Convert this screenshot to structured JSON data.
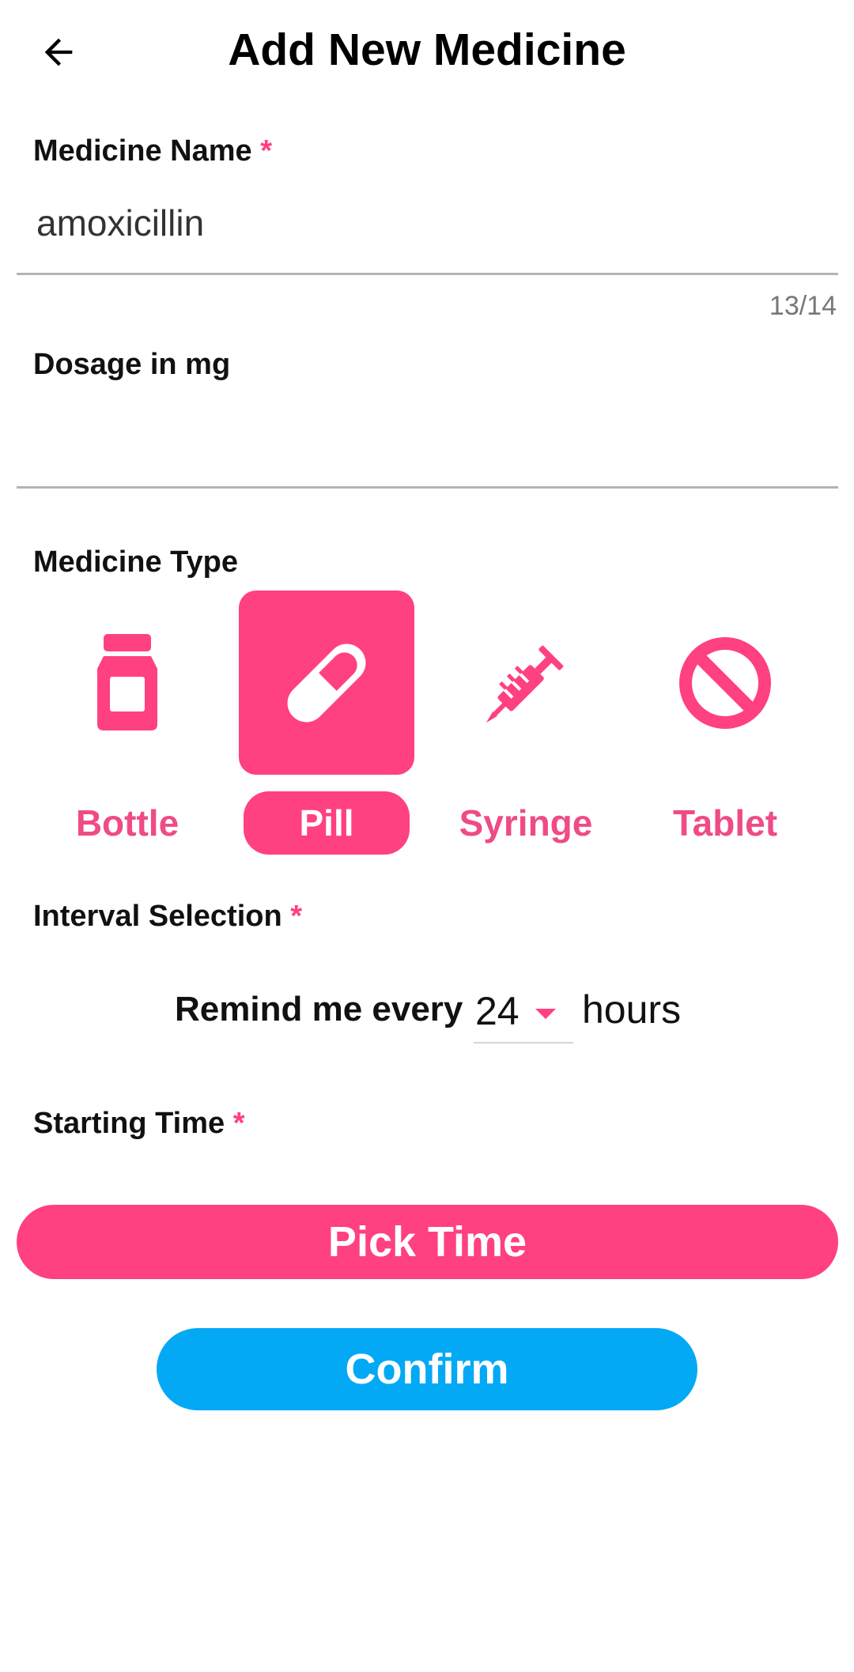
{
  "header": {
    "title": "Add New Medicine",
    "back_icon": "arrow-left-icon"
  },
  "medicine_name": {
    "label": "Medicine Name",
    "required_mark": "*",
    "value": "amoxicillin",
    "counter": "13/14"
  },
  "dosage": {
    "label": "Dosage in mg",
    "value": ""
  },
  "medicine_type": {
    "label": "Medicine Type",
    "selected": "Pill",
    "options": [
      {
        "label": "Bottle",
        "icon": "bottle-icon"
      },
      {
        "label": "Pill",
        "icon": "pill-icon"
      },
      {
        "label": "Syringe",
        "icon": "syringe-icon"
      },
      {
        "label": "Tablet",
        "icon": "tablet-icon"
      }
    ]
  },
  "interval": {
    "label": "Interval Selection",
    "required_mark": "*",
    "prefix": "Remind me every",
    "value": "24",
    "suffix": "hours"
  },
  "starting_time": {
    "label": "Starting Time",
    "required_mark": "*",
    "button_label": "Pick Time"
  },
  "confirm_label": "Confirm",
  "colors": {
    "accent": "#ff4081",
    "confirm": "#03a9f4"
  }
}
